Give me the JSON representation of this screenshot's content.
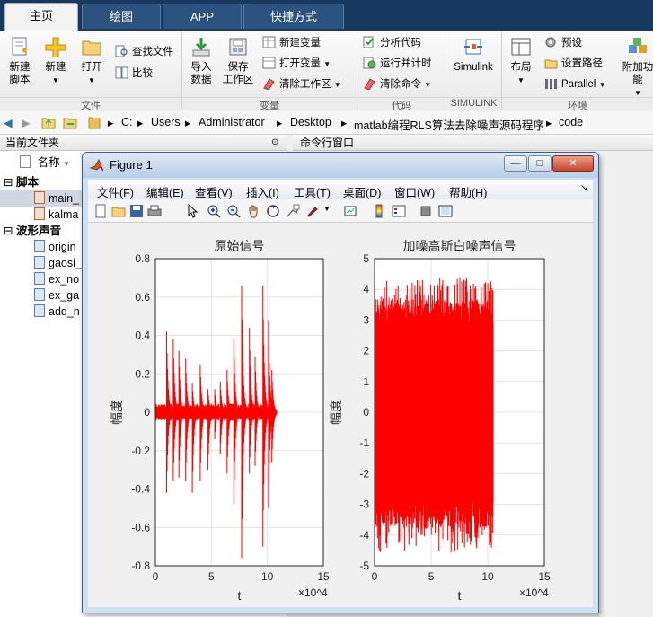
{
  "tabs": [
    "主页",
    "绘图",
    "APP",
    "快捷方式"
  ],
  "ribbon": {
    "new_script": "新建\n脚本",
    "new": "新建",
    "open": "打开",
    "find_files": "查找文件",
    "compare": "比较",
    "import_data": "导入\n数据",
    "save_workspace": "保存\n工作区",
    "new_variable": "新建变量",
    "open_variable": "打开变量",
    "clear_workspace": "清除工作区",
    "analyze_code": "分析代码",
    "run_and_time": "运行并计时",
    "clear_commands": "清除命令",
    "simulink": "Simulink",
    "layout": "布局",
    "preferences": "预设",
    "set_path": "设置路径",
    "parallel": "Parallel",
    "addons": "附加功能",
    "groups": [
      "文件",
      "变量",
      "代码",
      "SIMULINK",
      "环境"
    ]
  },
  "address": {
    "parts": [
      "C:",
      "Users",
      "Administrator",
      "Desktop",
      "matlab编程RLS算法去除噪声源码程序",
      "code"
    ]
  },
  "file_panel": {
    "title": "当前文件夹",
    "name_col": "名称",
    "sections": [
      {
        "label": "脚本",
        "items": [
          "main_",
          "kalma"
        ]
      },
      {
        "label": "波形声音",
        "items": [
          "origin",
          "gaosi_",
          "ex_no",
          "ex_ga",
          "add_n"
        ]
      }
    ]
  },
  "command_window": {
    "title": "命令行窗口"
  },
  "figure": {
    "title": "Figure 1",
    "menu": [
      "文件(F)",
      "编辑(E)",
      "查看(V)",
      "插入(I)",
      "工具(T)",
      "桌面(D)",
      "窗口(W)",
      "帮助(H)"
    ],
    "win_min": "—",
    "win_max": "□",
    "win_close": "✕"
  },
  "chart_data": [
    {
      "type": "line",
      "title": "原始信号",
      "xlabel": "t",
      "ylabel": "幅度",
      "xlim": [
        0,
        150000
      ],
      "ylim": [
        -0.8,
        0.8
      ],
      "x_ticks": [
        "0",
        "5",
        "10",
        "15"
      ],
      "x_exponent": "×10^4",
      "y_ticks": [
        "0.8",
        "0.6",
        "0.4",
        "0.2",
        "0",
        "-0.2",
        "-0.4",
        "-0.6",
        "-0.8"
      ],
      "series_color": "#ff0000",
      "signal_end": 105000,
      "peaks": [
        {
          "x": 10000,
          "max": 0.42,
          "min": -0.42
        },
        {
          "x": 16000,
          "max": 0.38,
          "min": -0.36
        },
        {
          "x": 21000,
          "max": 0.32,
          "min": -0.34
        },
        {
          "x": 27000,
          "max": 0.28,
          "min": -0.36
        },
        {
          "x": 33000,
          "max": 0.15,
          "min": -0.42
        },
        {
          "x": 40000,
          "max": 0.25,
          "min": -0.36
        },
        {
          "x": 47000,
          "max": 0.12,
          "min": -0.3
        },
        {
          "x": 53000,
          "max": 0.12,
          "min": -0.14
        },
        {
          "x": 58000,
          "max": 0.16,
          "min": -0.22
        },
        {
          "x": 64000,
          "max": 0.22,
          "min": -0.32
        },
        {
          "x": 70000,
          "max": 0.38,
          "min": -0.48
        },
        {
          "x": 77000,
          "max": 0.66,
          "min": -0.76
        },
        {
          "x": 84000,
          "max": 0.44,
          "min": -0.32
        },
        {
          "x": 89000,
          "max": 0.29,
          "min": -0.28
        },
        {
          "x": 96000,
          "max": 0.66,
          "min": -0.7
        },
        {
          "x": 101000,
          "max": 0.48,
          "min": -0.5
        },
        {
          "x": 104000,
          "max": 0.22,
          "min": -0.26
        }
      ]
    },
    {
      "type": "line",
      "title": "加噪高斯白噪声信号",
      "xlabel": "t",
      "ylabel": "幅度",
      "xlim": [
        0,
        150000
      ],
      "ylim": [
        -5,
        5
      ],
      "x_ticks": [
        "0",
        "5",
        "10",
        "15"
      ],
      "x_exponent": "×10^4",
      "y_ticks": [
        "5",
        "4",
        "3",
        "2",
        "1",
        "0",
        "-1",
        "-2",
        "-3",
        "-4",
        "-5"
      ],
      "series_color": "#ff0000",
      "signal_end": 105000,
      "band": [
        -2.8,
        2.8
      ],
      "extreme": [
        -4.6,
        4.4
      ]
    }
  ]
}
